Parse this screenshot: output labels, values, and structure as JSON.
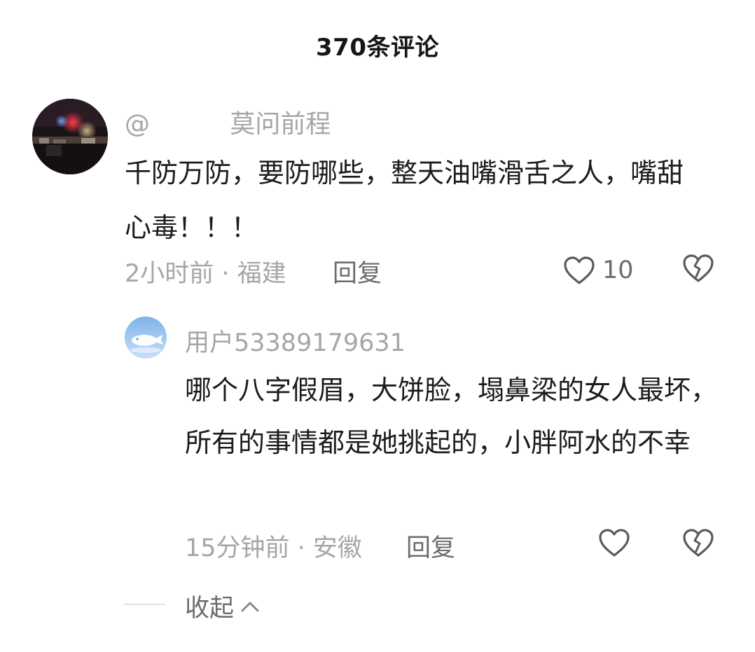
{
  "header": {
    "title": "370条评论"
  },
  "comment": {
    "author": "@          莫问前程",
    "text": "千防万防，要防哪些，整天油嘴滑舌之人，嘴甜心毒！！！",
    "meta": "2小时前 · 福建",
    "reply_label": "回复",
    "like_count": "10",
    "avatar_icon": "night-scene-avatar",
    "like_icon": "heart-outline-icon",
    "dislike_icon": "broken-heart-icon"
  },
  "reply": {
    "author": "用户53389179631",
    "text": "哪个八字假眉，大饼脸，塌鼻梁的女人最坏，所有的事情都是她挑起的，小胖阿水的不幸",
    "meta": "15分钟前 · 安徽",
    "reply_label": "回复",
    "avatar_icon": "whale-avatar",
    "like_icon": "heart-outline-icon",
    "dislike_icon": "broken-heart-icon"
  },
  "collapse": {
    "label": "收起",
    "icon": "chevron-up-icon"
  },
  "colors": {
    "primary_text": "#1c1c1c",
    "secondary_text": "#a6a6a6",
    "action_text": "#6c6c6c",
    "icon_stroke": "#5a5a5a"
  }
}
